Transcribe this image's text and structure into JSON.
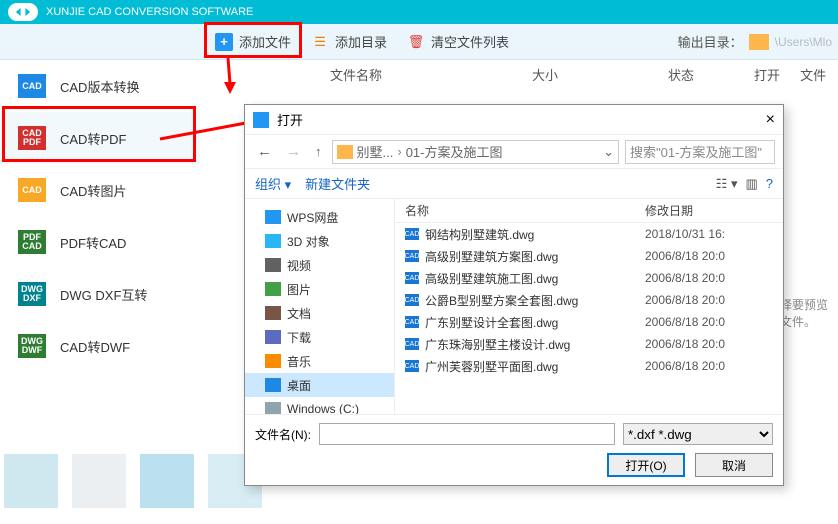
{
  "app": {
    "title": "XUNJIE CAD CONVERSION SOFTWARE"
  },
  "toolbar": {
    "add_file": "添加文件",
    "add_dir": "添加目录",
    "clear_list": "清空文件列表",
    "output_label": "输出目录：",
    "output_path": "\\Users\\Mlo"
  },
  "sidebar": {
    "items": [
      {
        "label": "CAD版本转换",
        "iconbg": "#1e88e5"
      },
      {
        "label": "CAD转PDF",
        "iconbg": "#d32f2f"
      },
      {
        "label": "CAD转图片",
        "iconbg": "#f9a825"
      },
      {
        "label": "PDF转CAD",
        "iconbg": "#2e7d32"
      },
      {
        "label": "DWG DXF互转",
        "iconbg": "#00838f"
      },
      {
        "label": "CAD转DWF",
        "iconbg": "#2e7d32"
      }
    ]
  },
  "main_columns": {
    "c1": "文件名称",
    "c2": "大小",
    "c3": "状态",
    "c4": "打开",
    "c5": "文件"
  },
  "placeholder": {
    "line1": "选择要预览",
    "line2": "的文件。"
  },
  "dialog": {
    "title": "打开",
    "crumb1": "别墅...",
    "crumb2": "01-方案及施工图",
    "search_placeholder": "搜索\"01-方案及施工图\"",
    "organize": "组织",
    "newfolder": "新建文件夹",
    "tree": [
      {
        "label": "WPS网盘",
        "ic": "#2196f3"
      },
      {
        "label": "3D 对象",
        "ic": "#29b6f6"
      },
      {
        "label": "视频",
        "ic": "#616161"
      },
      {
        "label": "图片",
        "ic": "#43a047"
      },
      {
        "label": "文档",
        "ic": "#795548"
      },
      {
        "label": "下载",
        "ic": "#5c6bc0"
      },
      {
        "label": "音乐",
        "ic": "#fb8c00"
      },
      {
        "label": "桌面",
        "ic": "#1e88e5",
        "sel": true
      },
      {
        "label": "Windows (C:)",
        "ic": "#90a4ae"
      }
    ],
    "list_head": {
      "name": "名称",
      "date": "修改日期"
    },
    "files": [
      {
        "name": "钢结构别墅建筑.dwg",
        "date": "2018/10/31 16:"
      },
      {
        "name": "高级别墅建筑方案图.dwg",
        "date": "2006/8/18 20:0"
      },
      {
        "name": "高级别墅建筑施工图.dwg",
        "date": "2006/8/18 20:0"
      },
      {
        "name": "公爵B型别墅方案全套图.dwg",
        "date": "2006/8/18 20:0"
      },
      {
        "name": "广东别墅设计全套图.dwg",
        "date": "2006/8/18 20:0"
      },
      {
        "name": "广东珠海别墅主楼设计.dwg",
        "date": "2006/8/18 20:0"
      },
      {
        "name": "广州芙蓉别墅平面图.dwg",
        "date": "2006/8/18 20:0"
      }
    ],
    "filename_label": "文件名(N):",
    "filter": "*.dxf *.dwg",
    "open_btn": "打开(O)",
    "cancel_btn": "取消"
  }
}
